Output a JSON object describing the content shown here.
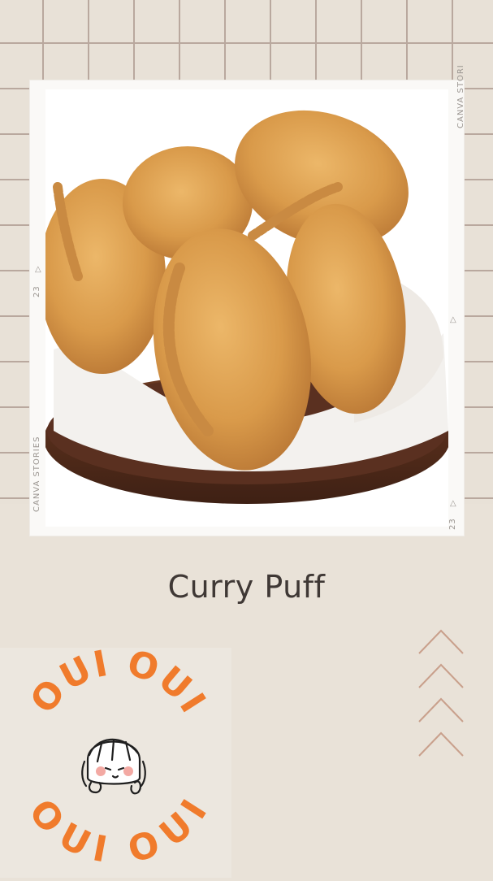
{
  "story": {
    "title": "Curry Puff",
    "frame_marks": {
      "brand_top": "CANVA STORI",
      "brand_bottom": "CANVA STORIES",
      "frame_number_left": "23",
      "frame_number_right": "23"
    },
    "logo": {
      "text_top": "OUI OUI",
      "text_bottom": "OUI OUI",
      "accent_color": "#f07b2c"
    },
    "colors": {
      "background": "#e9e2d8",
      "grid_line": "#b9a89e",
      "title": "#3f3835",
      "chevron": "#c9a08c"
    },
    "icons": {
      "chevrons": "chevron-up-stack-icon",
      "mascot": "girl-face-icon"
    }
  }
}
